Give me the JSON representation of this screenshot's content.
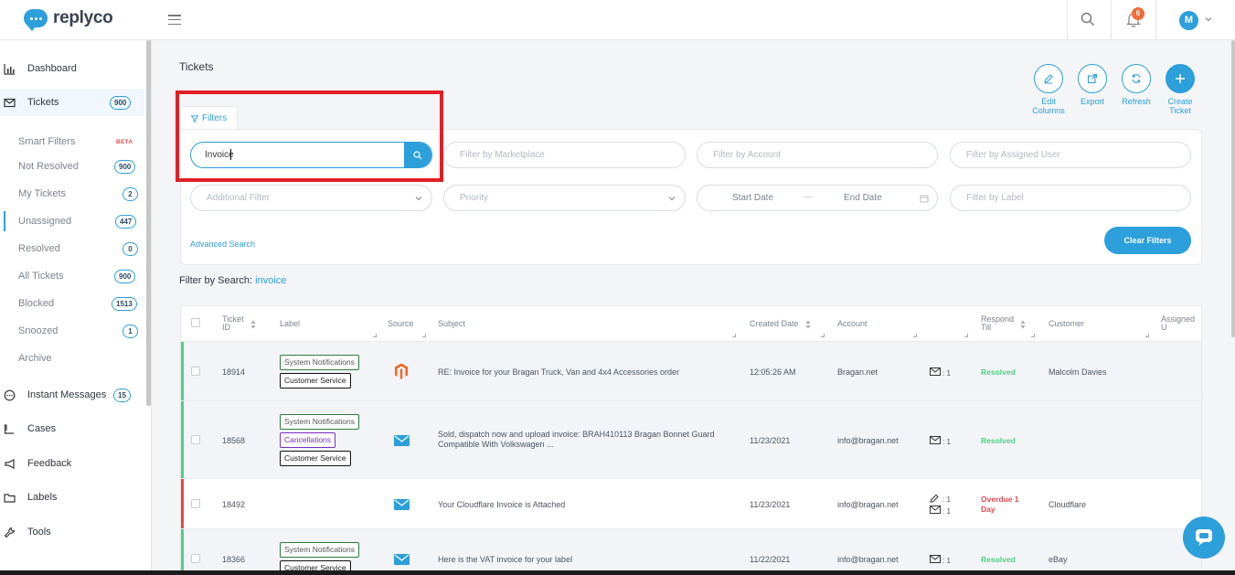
{
  "app": {
    "name": "replyco"
  },
  "header": {
    "notification_count": "6",
    "avatar_initial": "M"
  },
  "sidebar": {
    "dashboard": "Dashboard",
    "tickets": {
      "label": "Tickets",
      "count": "900"
    },
    "sub": [
      {
        "label": "Smart Filters",
        "badge": "BETA"
      },
      {
        "label": "Not Resolved",
        "count": "900"
      },
      {
        "label": "My Tickets",
        "count": "2"
      },
      {
        "label": "Unassigned",
        "count": "447"
      },
      {
        "label": "Resolved",
        "count": "0"
      },
      {
        "label": "All Tickets",
        "count": "900"
      },
      {
        "label": "Blocked",
        "count": "1513"
      },
      {
        "label": "Snoozed",
        "count": "1"
      },
      {
        "label": "Archive"
      }
    ],
    "instant_messages": {
      "label": "Instant Messages",
      "count": "15"
    },
    "cases": "Cases",
    "feedback": "Feedback",
    "labels": "Labels",
    "tools": "Tools"
  },
  "page": {
    "title": "Tickets"
  },
  "actions": {
    "edit_columns_1": "Edit",
    "edit_columns_2": "Columns",
    "export": "Export",
    "refresh": "Refresh",
    "create_1": "Create",
    "create_2": "Ticket"
  },
  "filters": {
    "tab_label": "Filters",
    "search_value": "Invoice",
    "marketplace_placeholder": "Filter by Marketplace",
    "account_placeholder": "Filter by Account",
    "assigned_placeholder": "Filter by Assigned User",
    "additional_placeholder": "Additional Filter",
    "priority_placeholder": "Priority",
    "start_date": "Start Date",
    "date_sep": "—",
    "end_date": "End Date",
    "label_placeholder": "Filter by Label",
    "advanced_search": "Advanced Search",
    "clear_filters": "Clear Filters"
  },
  "search_summary": {
    "prefix": "Filter by Search:",
    "query": "invoice"
  },
  "table": {
    "headers": {
      "ticket_id_1": "Ticket",
      "ticket_id_2": "ID",
      "label": "Label",
      "source": "Source",
      "subject": "Subject",
      "created": "Created Date",
      "account": "Account",
      "respond_1": "Respond",
      "respond_2": "Till",
      "customer": "Customer",
      "assigned": "Assigned U"
    },
    "rows": [
      {
        "id": "18914",
        "labels": [
          "System Notifications",
          "Customer Service"
        ],
        "subject_1": "RE: Invoice for your Bragan Truck, Van and 4x4 Accessories order",
        "subject_2": "",
        "created": "12:05:26 AM",
        "account": "Bragan.net",
        "msg_count": ": 1",
        "status": "Resolved",
        "customer": "Malcolm Davies"
      },
      {
        "id": "18568",
        "labels": [
          "System Notifications",
          "Cancellations",
          "Customer Service"
        ],
        "subject_1": "Sold, dispatch now and upload invoice: BRAH410113 Bragan Bonnet Guard",
        "subject_2": "Compatible With Volkswagen ...",
        "created": "11/23/2021",
        "account": "info@bragan.net",
        "msg_count": ": 1",
        "status": "Resolved",
        "customer": ""
      },
      {
        "id": "18492",
        "labels": [],
        "subject_1": "Your Cloudflare Invoice is Attached",
        "subject_2": "",
        "created": "11/23/2021",
        "account": "info@bragan.net",
        "note_count": ": 1",
        "msg_count": ": 1",
        "status_1": "Overdue 1",
        "status_2": "Day",
        "customer": "Cloudflare"
      },
      {
        "id": "18366",
        "labels": [
          "System Notifications",
          "Customer Service"
        ],
        "subject_1": "Here is the VAT invoice for your label",
        "subject_2": "",
        "created": "11/22/2021",
        "account": "info@bragan.net",
        "msg_count": ": 1",
        "status": "Resolved",
        "customer": "eBay"
      }
    ]
  },
  "colors": {
    "accent": "#2d9fdb",
    "resolved": "#4fcf85",
    "overdue": "#e5484d",
    "highlight": "#e21f26"
  }
}
